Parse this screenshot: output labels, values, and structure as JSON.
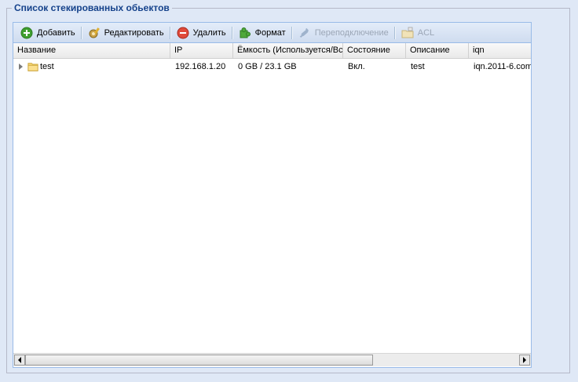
{
  "section": {
    "title": "Список стекированных обьектов"
  },
  "toolbar": {
    "add": "Добавить",
    "edit": "Редактировать",
    "delete": "Удалить",
    "format": "Формат",
    "reconnect": "Переподключение",
    "acl": "ACL"
  },
  "grid": {
    "columns": [
      "Название",
      "IP",
      "Ёмкость (Используется/Всего)",
      "Состояние",
      "Описание",
      "iqn"
    ],
    "rows": [
      {
        "name": "test",
        "ip": "192.168.1.20",
        "capacity": "0 GB / 23.1 GB",
        "status": "Вкл.",
        "description": "test",
        "iqn": "iqn.2011-6.com"
      }
    ]
  },
  "icons": {
    "add": "add-circle-icon",
    "edit": "gear-pencil-icon",
    "delete": "minus-circle-icon",
    "format": "puzzle-icon",
    "reconnect": "plug-icon",
    "acl": "folder-lock-icon",
    "row": "folder-icon",
    "expander": "triangle-right-icon"
  },
  "colors": {
    "background": "#dfe8f6",
    "title": "#15428b",
    "border": "#99bbe8"
  }
}
